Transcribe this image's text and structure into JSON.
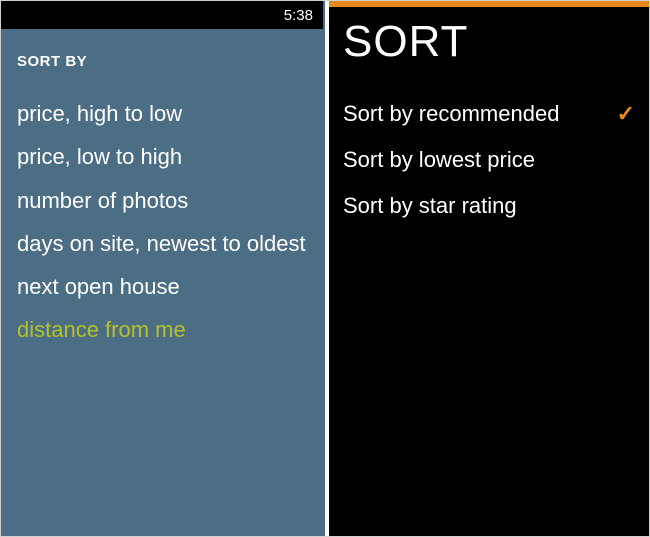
{
  "left": {
    "statusbar": {
      "time": "5:38"
    },
    "title": "SORT BY",
    "options": [
      {
        "label": "price, high to low",
        "selected": false
      },
      {
        "label": "price, low to high",
        "selected": false
      },
      {
        "label": "number of photos",
        "selected": false
      },
      {
        "label": "days on site, newest to oldest",
        "selected": false
      },
      {
        "label": "next open house",
        "selected": false
      },
      {
        "label": "distance from me",
        "selected": true
      }
    ],
    "selected_color": "#b6c12a",
    "bg_color": "#4b6e84"
  },
  "right": {
    "accent_color": "#e68a1e",
    "title": "SORT",
    "check_glyph": "✓",
    "options": [
      {
        "label": "Sort by recommended",
        "selected": true
      },
      {
        "label": "Sort by lowest price",
        "selected": false
      },
      {
        "label": "Sort by star rating",
        "selected": false
      }
    ]
  }
}
